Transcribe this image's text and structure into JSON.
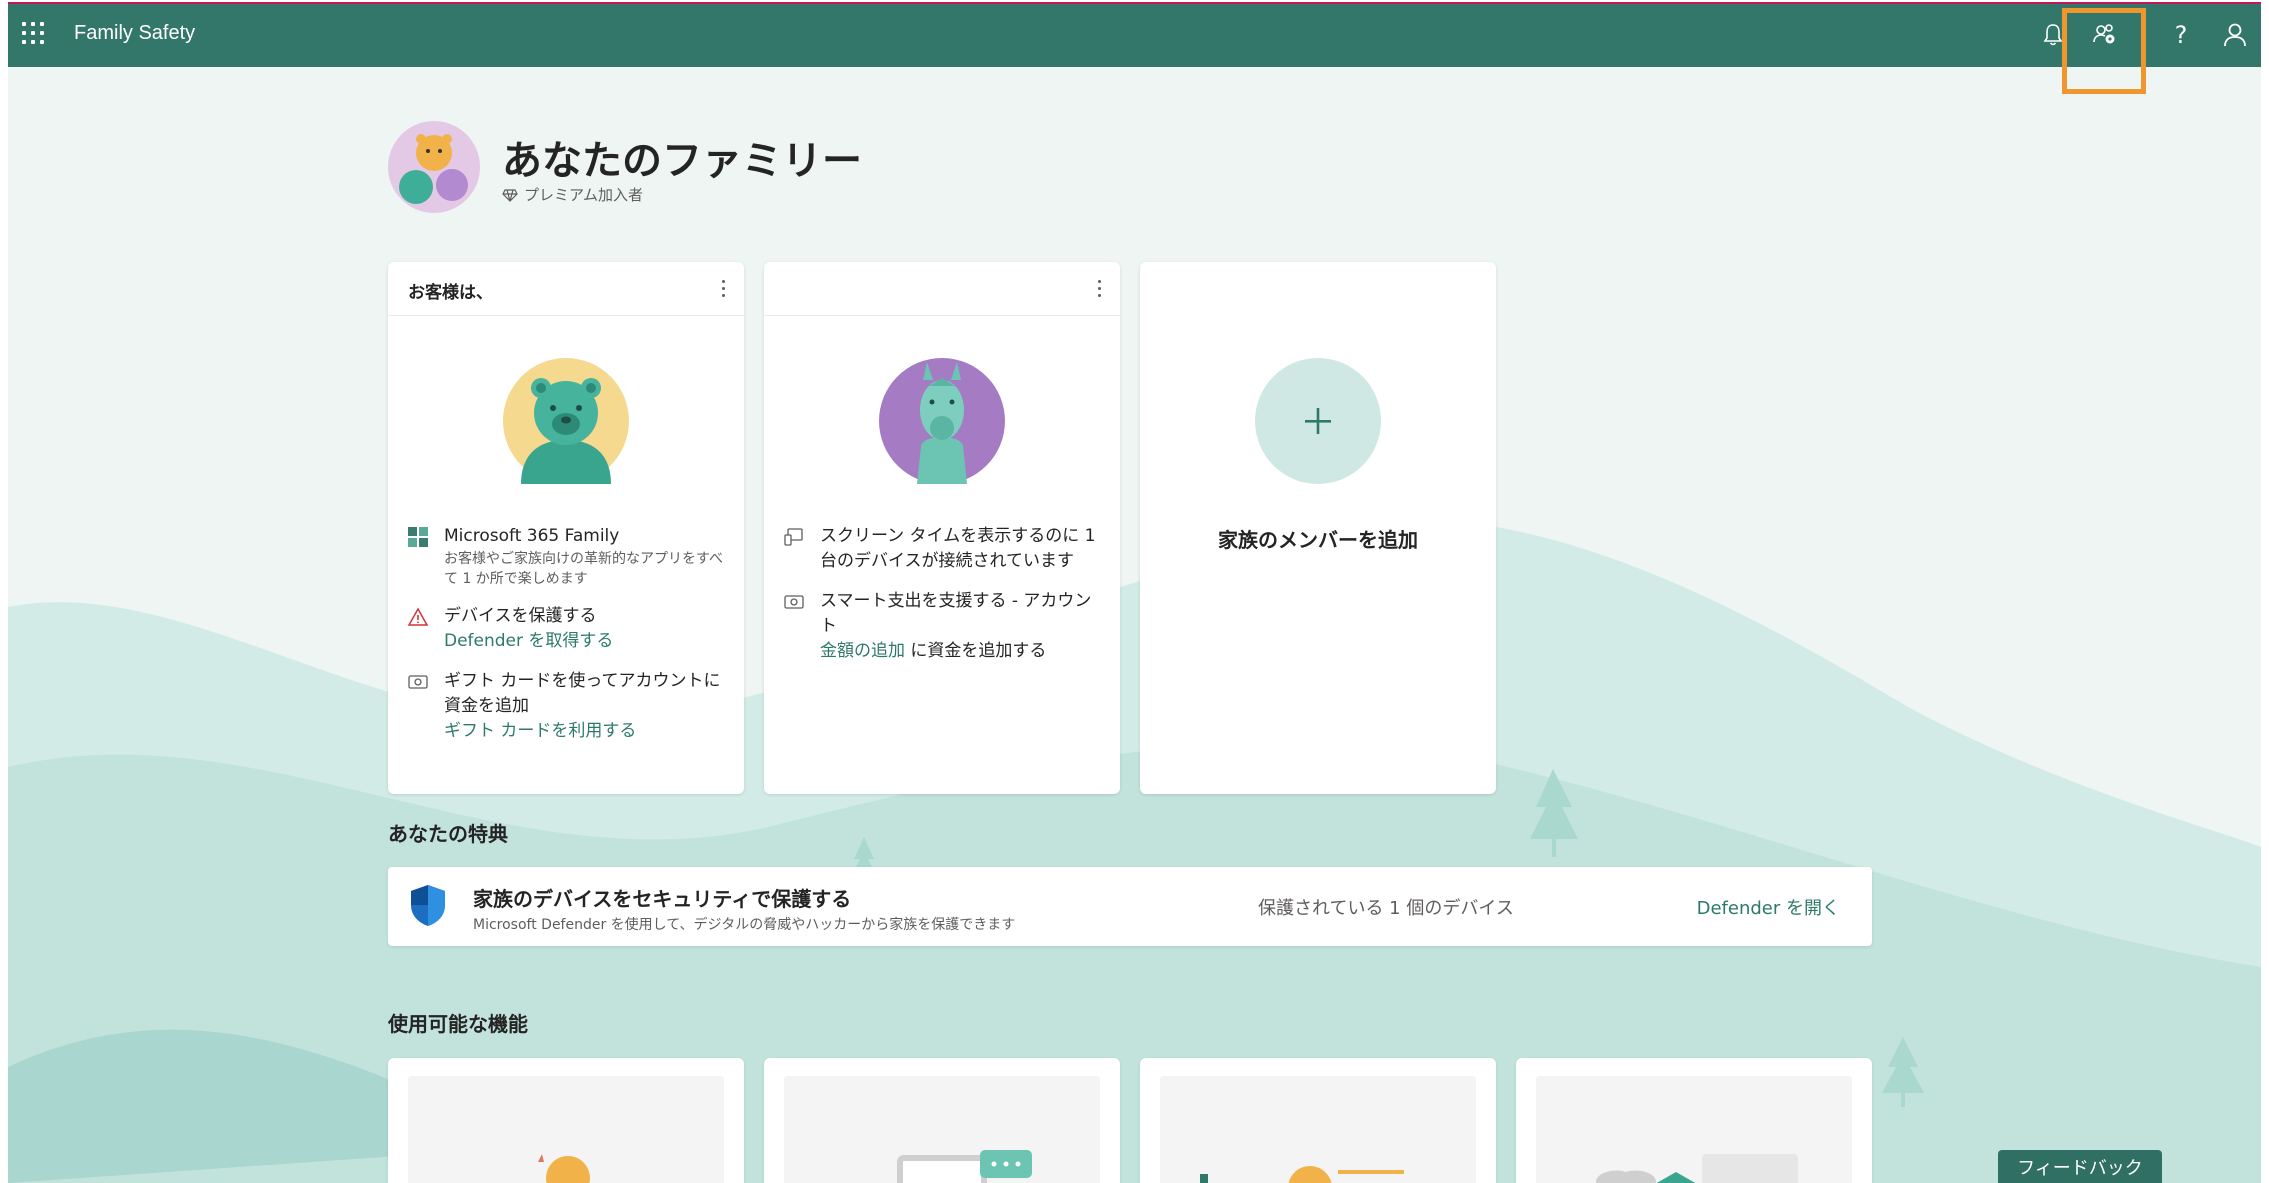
{
  "header": {
    "app_title": "Family Safety",
    "icons": [
      "waffle-icon",
      "bell-icon",
      "family-settings-icon",
      "help-icon",
      "account-icon"
    ],
    "help_glyph": "?"
  },
  "hero": {
    "title": "あなたのファミリー",
    "premium_label": "プレミアム加入者"
  },
  "cards": [
    {
      "header_label": "お客様は、",
      "avatar": "bear-avatar",
      "features": [
        {
          "icon": "windows-icon",
          "title": "Microsoft 365 Family",
          "sub": "お客様やご家族向けの革新的なアプリをすべて 1 か所で楽しめます"
        },
        {
          "icon": "warning-icon",
          "title": "デバイスを保護する",
          "link": "Defender を取得する"
        },
        {
          "icon": "money-icon",
          "title": "ギフト カードを使ってアカウントに資金を追加",
          "link": "ギフト カードを利用する"
        }
      ]
    },
    {
      "header_label": "",
      "avatar": "llama-avatar",
      "features": [
        {
          "icon": "device-icon",
          "title": "スクリーン タイムを表示するのに 1 台のデバイスが接続されています"
        },
        {
          "icon": "money-icon",
          "title": "スマート支出を支援する - アカウント",
          "link": "金額の追加",
          "suffix": " に資金を追加する"
        }
      ]
    },
    {
      "add_label": "家族のメンバーを追加"
    }
  ],
  "benefits": {
    "section_title": "あなたの特典",
    "banner_title": "家族のデバイスをセキュリティで保護する",
    "banner_sub": "Microsoft Defender を使用して、デジタルの脅威やハッカーから家族を保護できます",
    "banner_count": "保護されている 1 個のデバイス",
    "banner_link": "Defender を開く"
  },
  "features_section": {
    "title": "使用可能な機能"
  },
  "feedback_label": "フィードバック",
  "colors": {
    "header": "#33766a",
    "accent_link": "#2d7a6b",
    "highlight": "#f0962e",
    "background": "#eef5f3"
  }
}
